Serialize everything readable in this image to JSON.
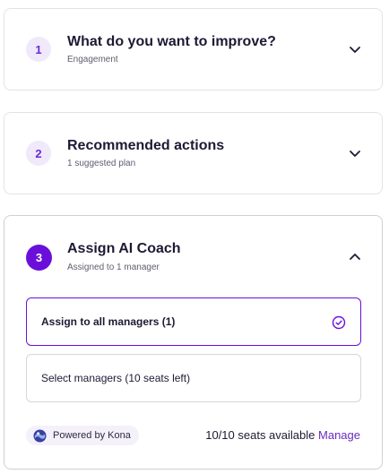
{
  "steps": [
    {
      "number": "1",
      "title": "What do you want to improve?",
      "subtitle": "Engagement",
      "expanded": false
    },
    {
      "number": "2",
      "title": "Recommended actions",
      "subtitle": "1 suggested plan",
      "expanded": false
    },
    {
      "number": "3",
      "title": "Assign AI Coach",
      "subtitle": "Assigned to 1 manager",
      "expanded": true
    }
  ],
  "assign": {
    "options": [
      {
        "label": "Assign to all managers (1)",
        "selected": true
      },
      {
        "label": "Select managers (10 seats left)",
        "selected": false
      }
    ],
    "powered_by": "Powered by Kona",
    "seats_text": "10/10 seats available",
    "manage_label": "Manage"
  },
  "icons": {
    "collapsed": "chevron-down-icon",
    "expanded": "chevron-up-icon",
    "selected": "check-circle-icon",
    "brand": "kona-logo-icon"
  },
  "colors": {
    "accent": "#6a0fd9",
    "step_inactive_bg": "#efe9fb",
    "link": "#6a2bbf"
  }
}
